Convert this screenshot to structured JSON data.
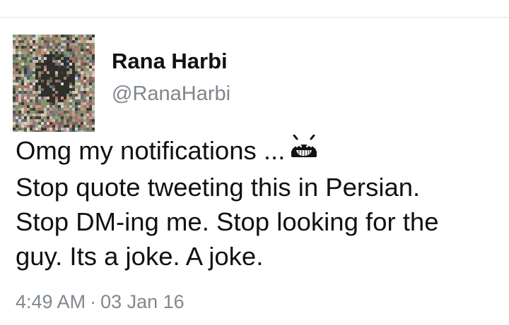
{
  "tweet": {
    "author_name": "Rana Harbi",
    "author_handle": "@RanaHarbi",
    "avatar_icon": "noise-avatar-icon",
    "text_lines": [
      "Omg my notifications ...",
      "Stop quote tweeting this in Persian.",
      "Stop DM-ing me. Stop looking for the",
      "guy. Its a joke. A joke."
    ],
    "emoji_icon": "android-laughing-icon",
    "time": "4:49 AM",
    "separator": "·",
    "date": "03 Jan 16"
  },
  "colors": {
    "name": "#111111",
    "handle": "#7f868c",
    "meta": "#808890",
    "divider": "#e1e4e6"
  }
}
